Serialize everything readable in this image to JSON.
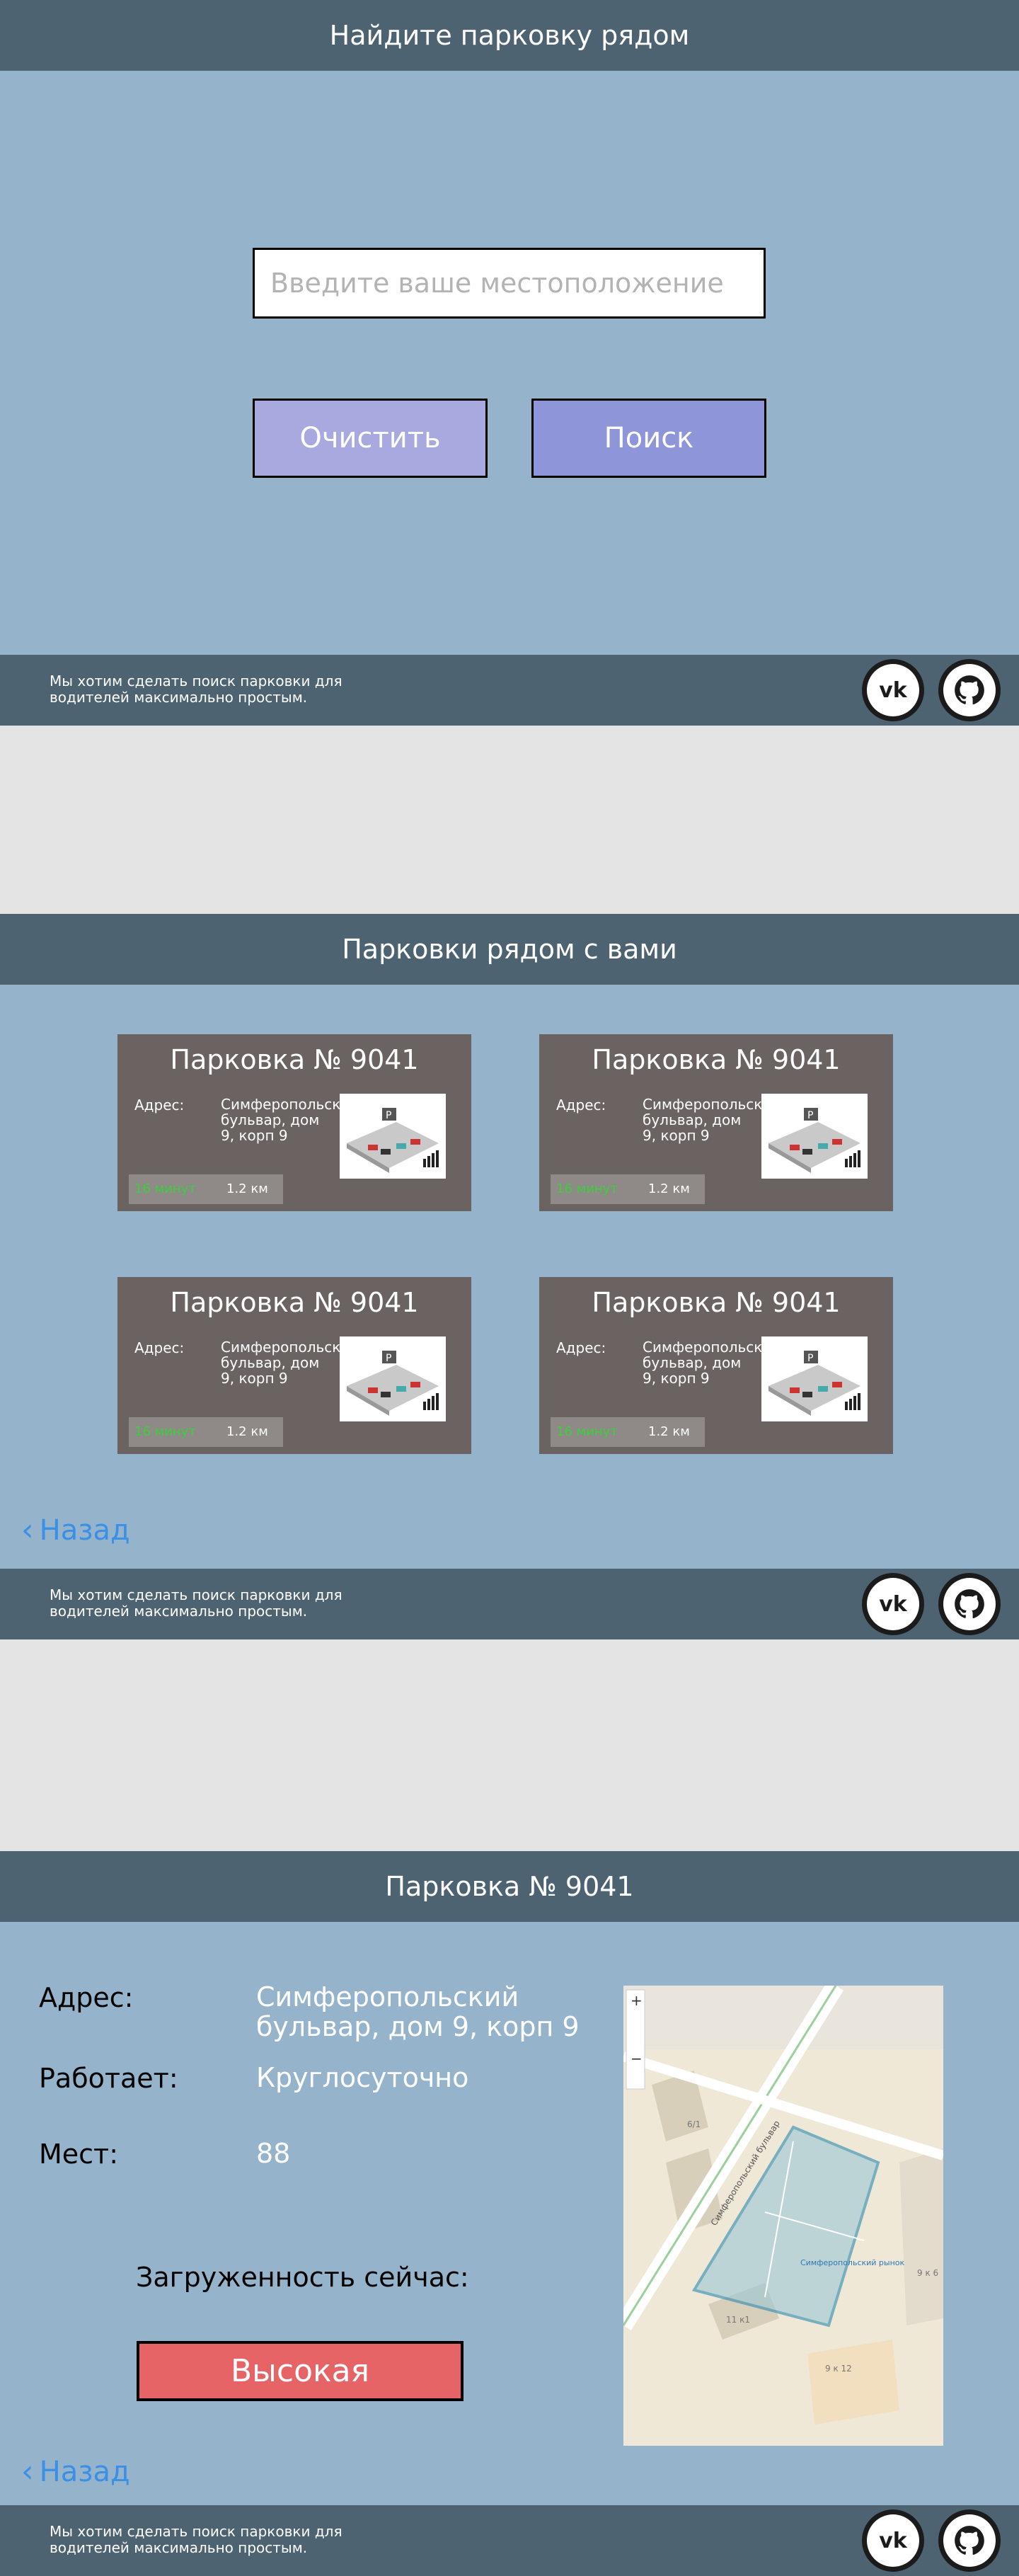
{
  "search_screen": {
    "header_title": "Найдите парковку рядом",
    "input_placeholder": "Введите ваше местоположение",
    "clear_label": "Очистить",
    "search_label": "Поиск"
  },
  "footer": {
    "text": "Мы хотим сделать поиск парковки для водителей максимально простым.",
    "vk_icon": "vk-icon",
    "github_icon": "github-icon"
  },
  "results_screen": {
    "header_title": "Парковки рядом с вами",
    "cards": [
      {
        "title": "Парковка № 9041",
        "address_label": "Адрес:",
        "address": "Симферопольский бульвар, дом 9, корп 9",
        "minutes": "16 минут",
        "distance": "1.2 км"
      },
      {
        "title": "Парковка № 9041",
        "address_label": "Адрес:",
        "address": "Симферопольский бульвар, дом 9, корп 9",
        "minutes": "16 минут",
        "distance": "1.2 км"
      },
      {
        "title": "Парковка № 9041",
        "address_label": "Адрес:",
        "address": "Симферопольский бульвар, дом 9, корп 9",
        "minutes": "16 минут",
        "distance": "1.2 км"
      },
      {
        "title": "Парковка № 9041",
        "address_label": "Адрес:",
        "address": "Симферопольский бульвар, дом 9, корп 9",
        "minutes": "16 минут",
        "distance": "1.2 км"
      }
    ],
    "back_label": "Назад"
  },
  "detail_screen": {
    "header_title": "Парковка № 9041",
    "address_label": "Адрес:",
    "address_value": "Симферопольский бульвар, дом 9, корп 9",
    "hours_label": "Работает:",
    "hours_value": "Круглосуточно",
    "spots_label": "Мест:",
    "spots_value": "88",
    "load_label": "Загруженность сейчас:",
    "load_value": "Высокая",
    "back_label": "Назад",
    "map": {
      "street_label": "Симферопольский бульвар",
      "zoom_in": "+",
      "zoom_out": "−",
      "house_labels": [
        "6/1",
        "9 к 6",
        "11 к1",
        "9 к 12",
        "Симферопольский рынок"
      ]
    }
  },
  "colors": {
    "header": "#4d6372",
    "band": "#95b4cb",
    "clear_button": "#a8a9df",
    "search_button": "#8f95d9",
    "card": "#6b6361",
    "load_high": "#e76466",
    "minutes": "#3bd03b",
    "link": "#3a8fe6"
  }
}
